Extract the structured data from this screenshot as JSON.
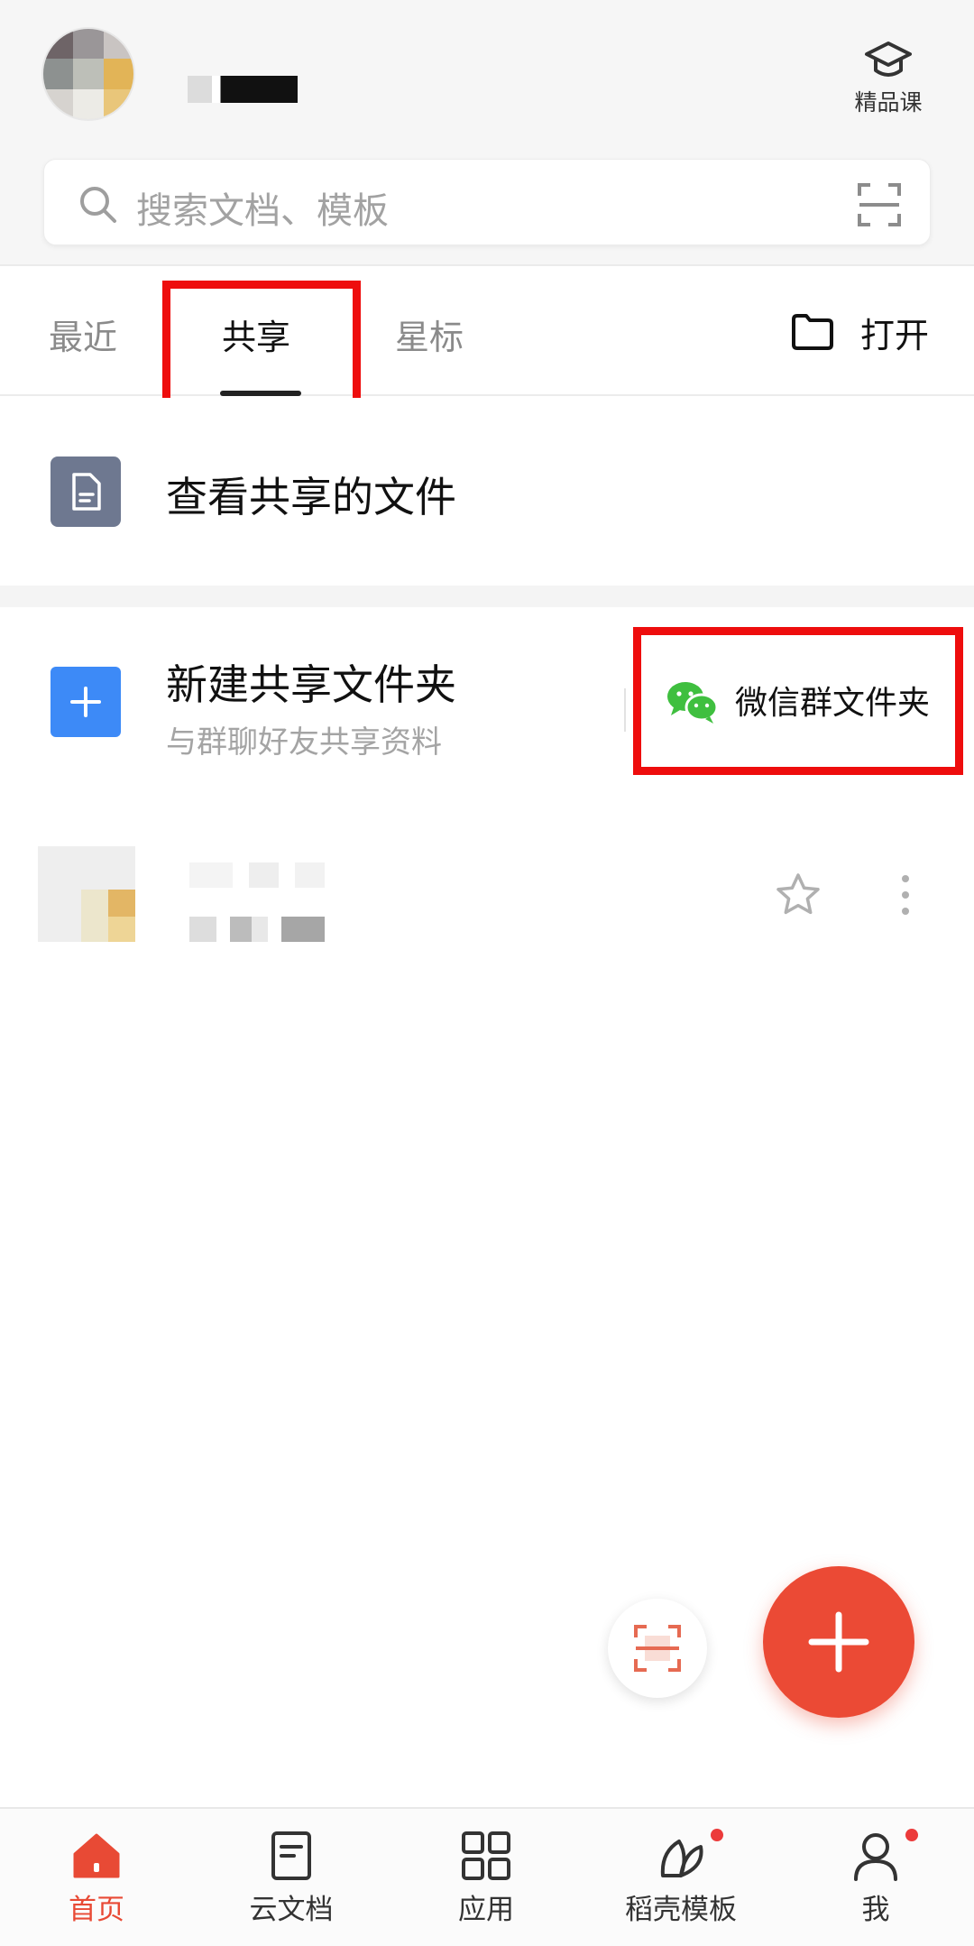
{
  "header": {
    "course_label": "精品课",
    "search_placeholder": "搜索文档、模板"
  },
  "tabs": [
    {
      "label": "最近",
      "active": false
    },
    {
      "label": "共享",
      "active": true
    },
    {
      "label": "星标",
      "active": false
    }
  ],
  "open_label": "打开",
  "shared_view": {
    "title": "查看共享的文件"
  },
  "new_shared_folder": {
    "title": "新建共享文件夹",
    "subtitle": "与群聊好友共享资料"
  },
  "wechat_folder_label": "微信群文件夹",
  "bottom_nav": [
    {
      "label": "首页",
      "icon": "home-icon",
      "active": true
    },
    {
      "label": "云文档",
      "icon": "cloud-doc-icon",
      "active": false
    },
    {
      "label": "应用",
      "icon": "apps-icon",
      "active": false
    },
    {
      "label": "稻壳模板",
      "icon": "template-leaf-icon",
      "active": false,
      "badge": true
    },
    {
      "label": "我",
      "icon": "profile-icon",
      "active": false,
      "badge": true
    }
  ],
  "colors": {
    "accent": "#eb4a35",
    "highlight": "#ee0d0d",
    "blue_tile": "#3d8af7",
    "wechat_green": "#3fbf3f"
  }
}
